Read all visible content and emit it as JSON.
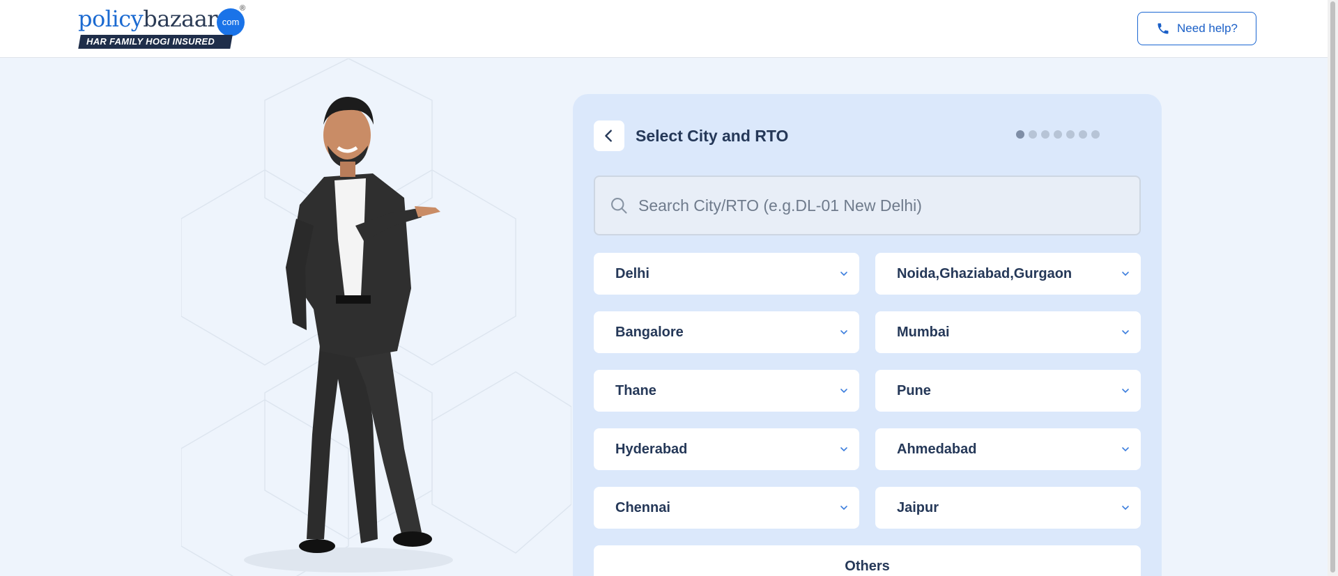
{
  "header": {
    "logo": {
      "word_part1": "policy",
      "word_part2": "bazaar",
      "dot": "com",
      "registered": "®",
      "tagline": "HAR FAMILY HOGI INSURED"
    },
    "help_button": {
      "label": "Need help?",
      "icon": "phone-icon"
    }
  },
  "card": {
    "back_icon": "chevron-left-icon",
    "title": "Select City and RTO",
    "steps": {
      "total": 7,
      "current": 1
    },
    "search": {
      "placeholder": "Search City/RTO (e.g.DL-01 New Delhi)",
      "value": ""
    },
    "cities": [
      {
        "label": "Delhi"
      },
      {
        "label": "Noida,Ghaziabad,Gurgaon"
      },
      {
        "label": "Bangalore"
      },
      {
        "label": "Mumbai"
      },
      {
        "label": "Thane"
      },
      {
        "label": "Pune"
      },
      {
        "label": "Hyderabad"
      },
      {
        "label": "Ahmedabad"
      },
      {
        "label": "Chennai"
      },
      {
        "label": "Jaipur"
      }
    ],
    "others_label": "Others"
  },
  "colors": {
    "brand_blue": "#1a73e8",
    "navy": "#253858",
    "page_bg": "#eef4fc",
    "card_bg": "#dbe8fb"
  }
}
